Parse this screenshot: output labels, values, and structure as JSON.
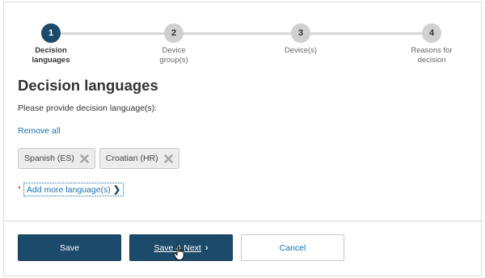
{
  "stepper": {
    "steps": [
      {
        "number": "1",
        "label_line1": "Decision",
        "label_line2": "languages",
        "active": true
      },
      {
        "number": "2",
        "label_line1": "Device",
        "label_line2": "group(s)",
        "active": false
      },
      {
        "number": "3",
        "label_line1": "Device(s)",
        "label_line2": "",
        "active": false
      },
      {
        "number": "4",
        "label_line1": "Reasons for",
        "label_line2": "decision",
        "active": false
      }
    ]
  },
  "main": {
    "title": "Decision languages",
    "instructions": "Please provide decision language(s):",
    "remove_all": "Remove all",
    "languages": [
      {
        "label": "Spanish (ES)"
      },
      {
        "label": "Croatian (HR)"
      }
    ],
    "required_marker": "*",
    "add_more": "Add more language(s)"
  },
  "footer": {
    "save_label": "Save",
    "save_next_label": "Save & Next",
    "cancel_label": "Cancel"
  },
  "colors": {
    "primary": "#1b4a6b",
    "link": "#1a6fb0",
    "required": "#d42a2a"
  },
  "icons": {
    "chip_remove": "close-icon",
    "add_more_chevron": "chevron-right-icon",
    "next_chevron": "chevron-right-icon",
    "pointer": "hand-cursor-icon"
  }
}
